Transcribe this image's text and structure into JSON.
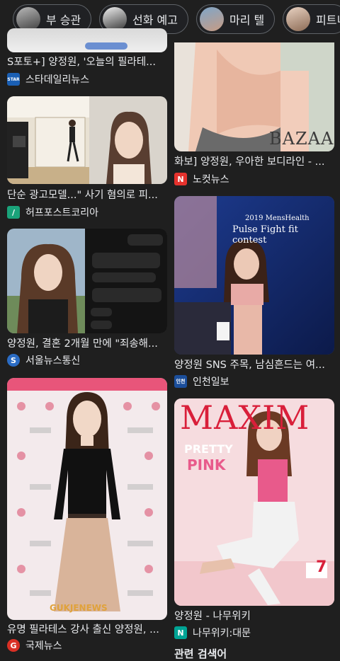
{
  "chips": [
    {
      "label": "부 승관",
      "icon": "person-thumbnail"
    },
    {
      "label": "선화 예고",
      "icon": "person-thumbnail"
    },
    {
      "label": "마리 텔",
      "icon": "person-thumbnail"
    },
    {
      "label": "피트니",
      "icon": "person-thumbnail"
    }
  ],
  "results": [
    {
      "caption": "S포토+] 양정원, '오늘의 필라테...",
      "source": "스타데일리뉴스",
      "favicon_text": "STAR",
      "favicon_color": "#1a5fb4"
    },
    {
      "caption": "화보] 양정원, 우아한 보디라인 - ...",
      "source": "노컷뉴스",
      "favicon_text": "N",
      "favicon_color": "#e5322d",
      "image_text": "BAZAAR"
    },
    {
      "caption": "단순 광고모델...\" 사기 혐의로 피...",
      "source": "허프포스트코리아",
      "favicon_text": "/",
      "favicon_color": "#1aa37a"
    },
    {
      "caption": "양정원 SNS 주목, 남심흔드는 여...",
      "source": "인천일보",
      "favicon_text": "인천",
      "favicon_color": "#1b4e9b",
      "image_text_1": "2019 MensHealth",
      "image_text_2": "Pulse Fight fit contest"
    },
    {
      "caption": "양정원, 결혼 2개월 만에 \"죄송해...",
      "source": "서울뉴스통신",
      "favicon_text": "S",
      "favicon_color": "#2b6cc4"
    },
    {
      "caption": "유명 필라테스 강사 출신 양정원, ...",
      "source": "국제뉴스",
      "favicon_text": "G",
      "favicon_color": "#d93025",
      "image_text": "GUKJENEWS"
    },
    {
      "caption": "양정원 - 나무위키",
      "source": "나무위키:대문",
      "favicon_text": "N",
      "favicon_color": "#00a495",
      "image_text_1": "MAXIM",
      "image_text_2": "PRETTY",
      "image_text_3": "PINK",
      "image_text_4": "7"
    }
  ],
  "bottom_heading": "관련 검색어"
}
